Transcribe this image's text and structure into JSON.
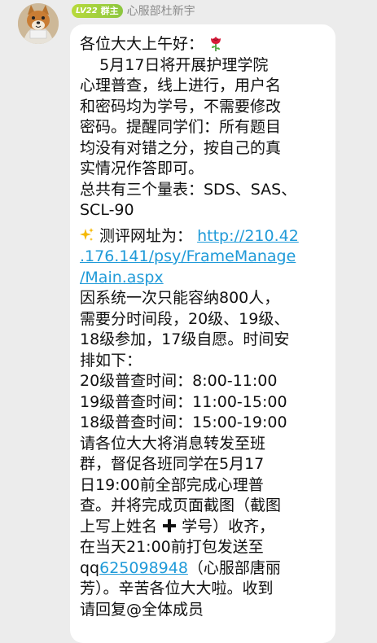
{
  "sender": {
    "badge_level": "LV22",
    "badge_role": "群主",
    "name": "心服部杜新宇"
  },
  "message": {
    "l1": "各位大大上午好：",
    "l2": "    5月17日将开展护理学院",
    "l3": "心理普查，线上进行，用户名",
    "l4": "和密码均为学号，不需要修改",
    "l5": "密码。提醒同学们：所有题目",
    "l6": "均没有对错之分，按自己的真",
    "l7": "实情况作答即可。",
    "l8": "总共有三个量表：SDS、SAS、",
    "l9": "SCL-90",
    "l10_prefix": "测评网址为：",
    "link_1": "http://210.42",
    "link_2": ".176.141/psy/FrameManage",
    "link_3": "/Main.aspx",
    "l11": "因系统一次只能容纳800人，",
    "l12": "需要分时间段，20级、19级、",
    "l13": "18级参加，17级自愿。时间安",
    "l14": "排如下：",
    "l15": "20级普查时间：8:00-11:00",
    "l16": "19级普查时间：11:00-15:00",
    "l17": "18级普查时间：15:00-19:00",
    "l18": "请各位大大将消息转发至班",
    "l19": "群，督促各班同学在5月17",
    "l20": "日19:00前全部完成心理普",
    "l21": "查。并将完成页面截图（截图",
    "l22_a": "上写上姓名",
    "l22_b": "学号）收齐，",
    "l23": "在当天21:00前打包发送至",
    "l24_prefix": "qq",
    "qq_number": "625098948",
    "l24_suffix": "（心服部唐丽",
    "l25": "芳）。辛苦各位大大啦。收到",
    "l26": "请回复@全体成员"
  },
  "icons": {
    "rose": "rose-icon",
    "sparkle": "sparkles-icon",
    "plus": "heavy-plus-icon"
  }
}
